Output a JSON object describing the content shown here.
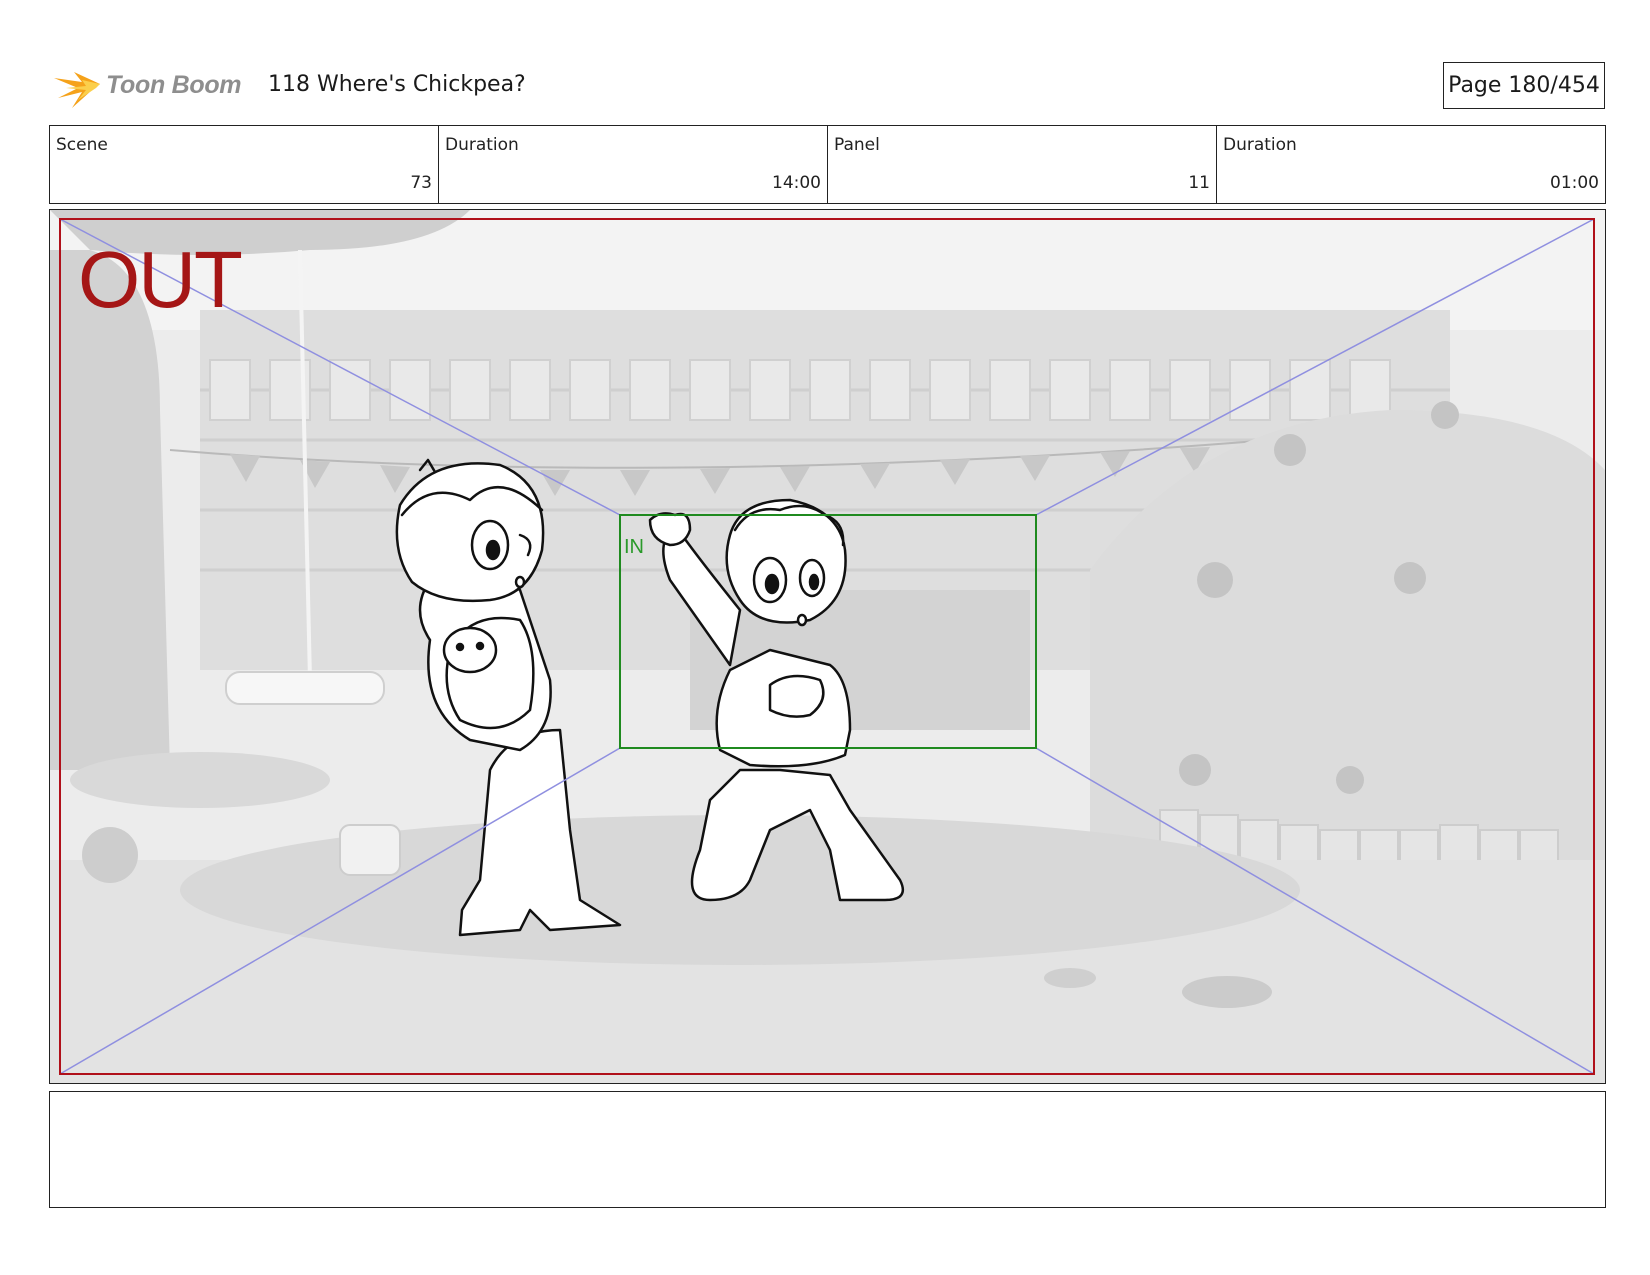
{
  "header": {
    "logo_text": "Toon Boom",
    "title": "118 Where's Chickpea?",
    "page_label": "Page 180/454"
  },
  "info": [
    {
      "label": "Scene",
      "value": "73"
    },
    {
      "label": "Duration",
      "value": "14:00"
    },
    {
      "label": "Panel",
      "value": "11"
    },
    {
      "label": "Duration",
      "value": "01:00"
    }
  ],
  "panel": {
    "out_label": "OUT",
    "in_label": "IN"
  },
  "notes": {
    "text": ""
  },
  "colors": {
    "out_frame": "#b0101a",
    "in_frame": "#1f8a1f",
    "diagonal": "#8f8fe0",
    "logo_orange": "#f5a21a"
  }
}
